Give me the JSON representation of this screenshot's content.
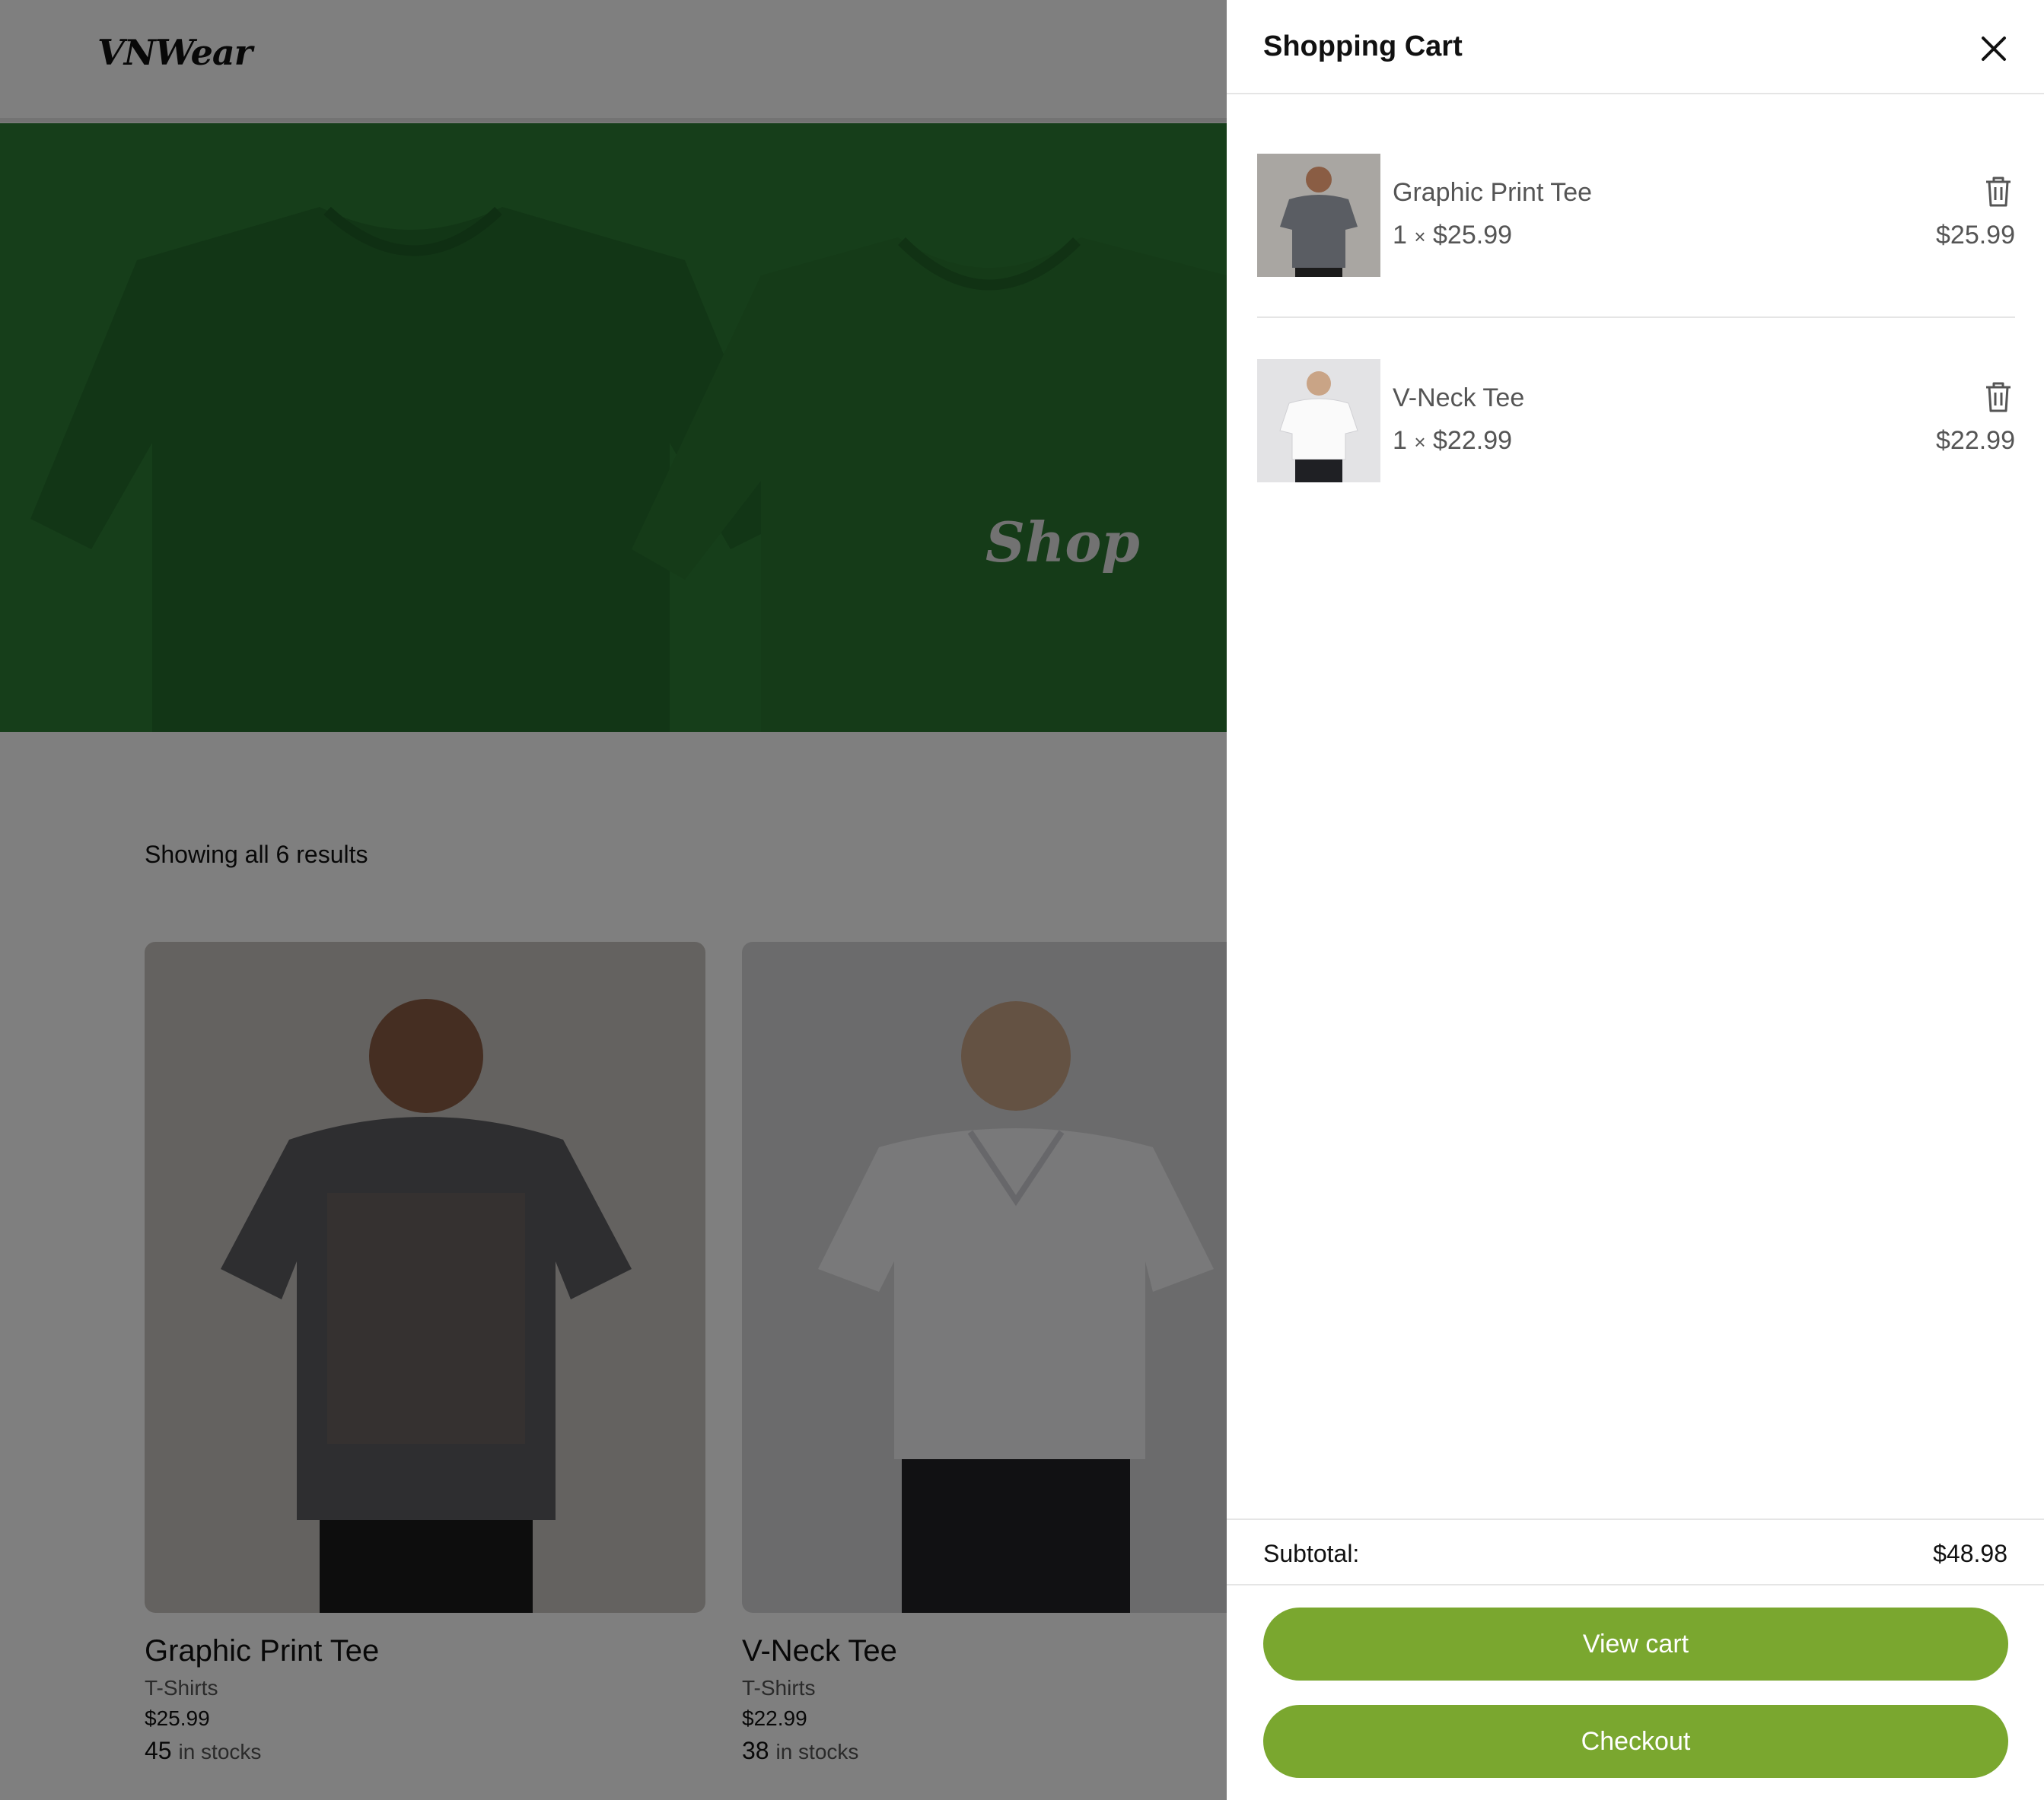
{
  "brand": {
    "logo_text": "VNWear"
  },
  "hero": {
    "title": "Shop",
    "color": "#2c7d34"
  },
  "shop": {
    "results_text": "Showing all 6 results",
    "stock_suffix": "in stocks",
    "products": [
      {
        "name": "Graphic Print Tee",
        "category": "T-Shirts",
        "price": "$25.99",
        "stock": "45"
      },
      {
        "name": "V-Neck Tee",
        "category": "T-Shirts",
        "price": "$22.99",
        "stock": "38"
      }
    ]
  },
  "cart": {
    "title": "Shopping Cart",
    "close_icon": "close-icon",
    "delete_icon": "trash-icon",
    "items": [
      {
        "name": "Graphic Print Tee",
        "qty": "1",
        "unit_price": "$25.99",
        "total": "$25.99"
      },
      {
        "name": "V-Neck Tee",
        "qty": "1",
        "unit_price": "$22.99",
        "total": "$22.99"
      }
    ],
    "subtotal_label": "Subtotal:",
    "subtotal_value": "$48.98",
    "view_cart_label": "View cart",
    "checkout_label": "Checkout",
    "accent_color": "#7aa72f"
  }
}
